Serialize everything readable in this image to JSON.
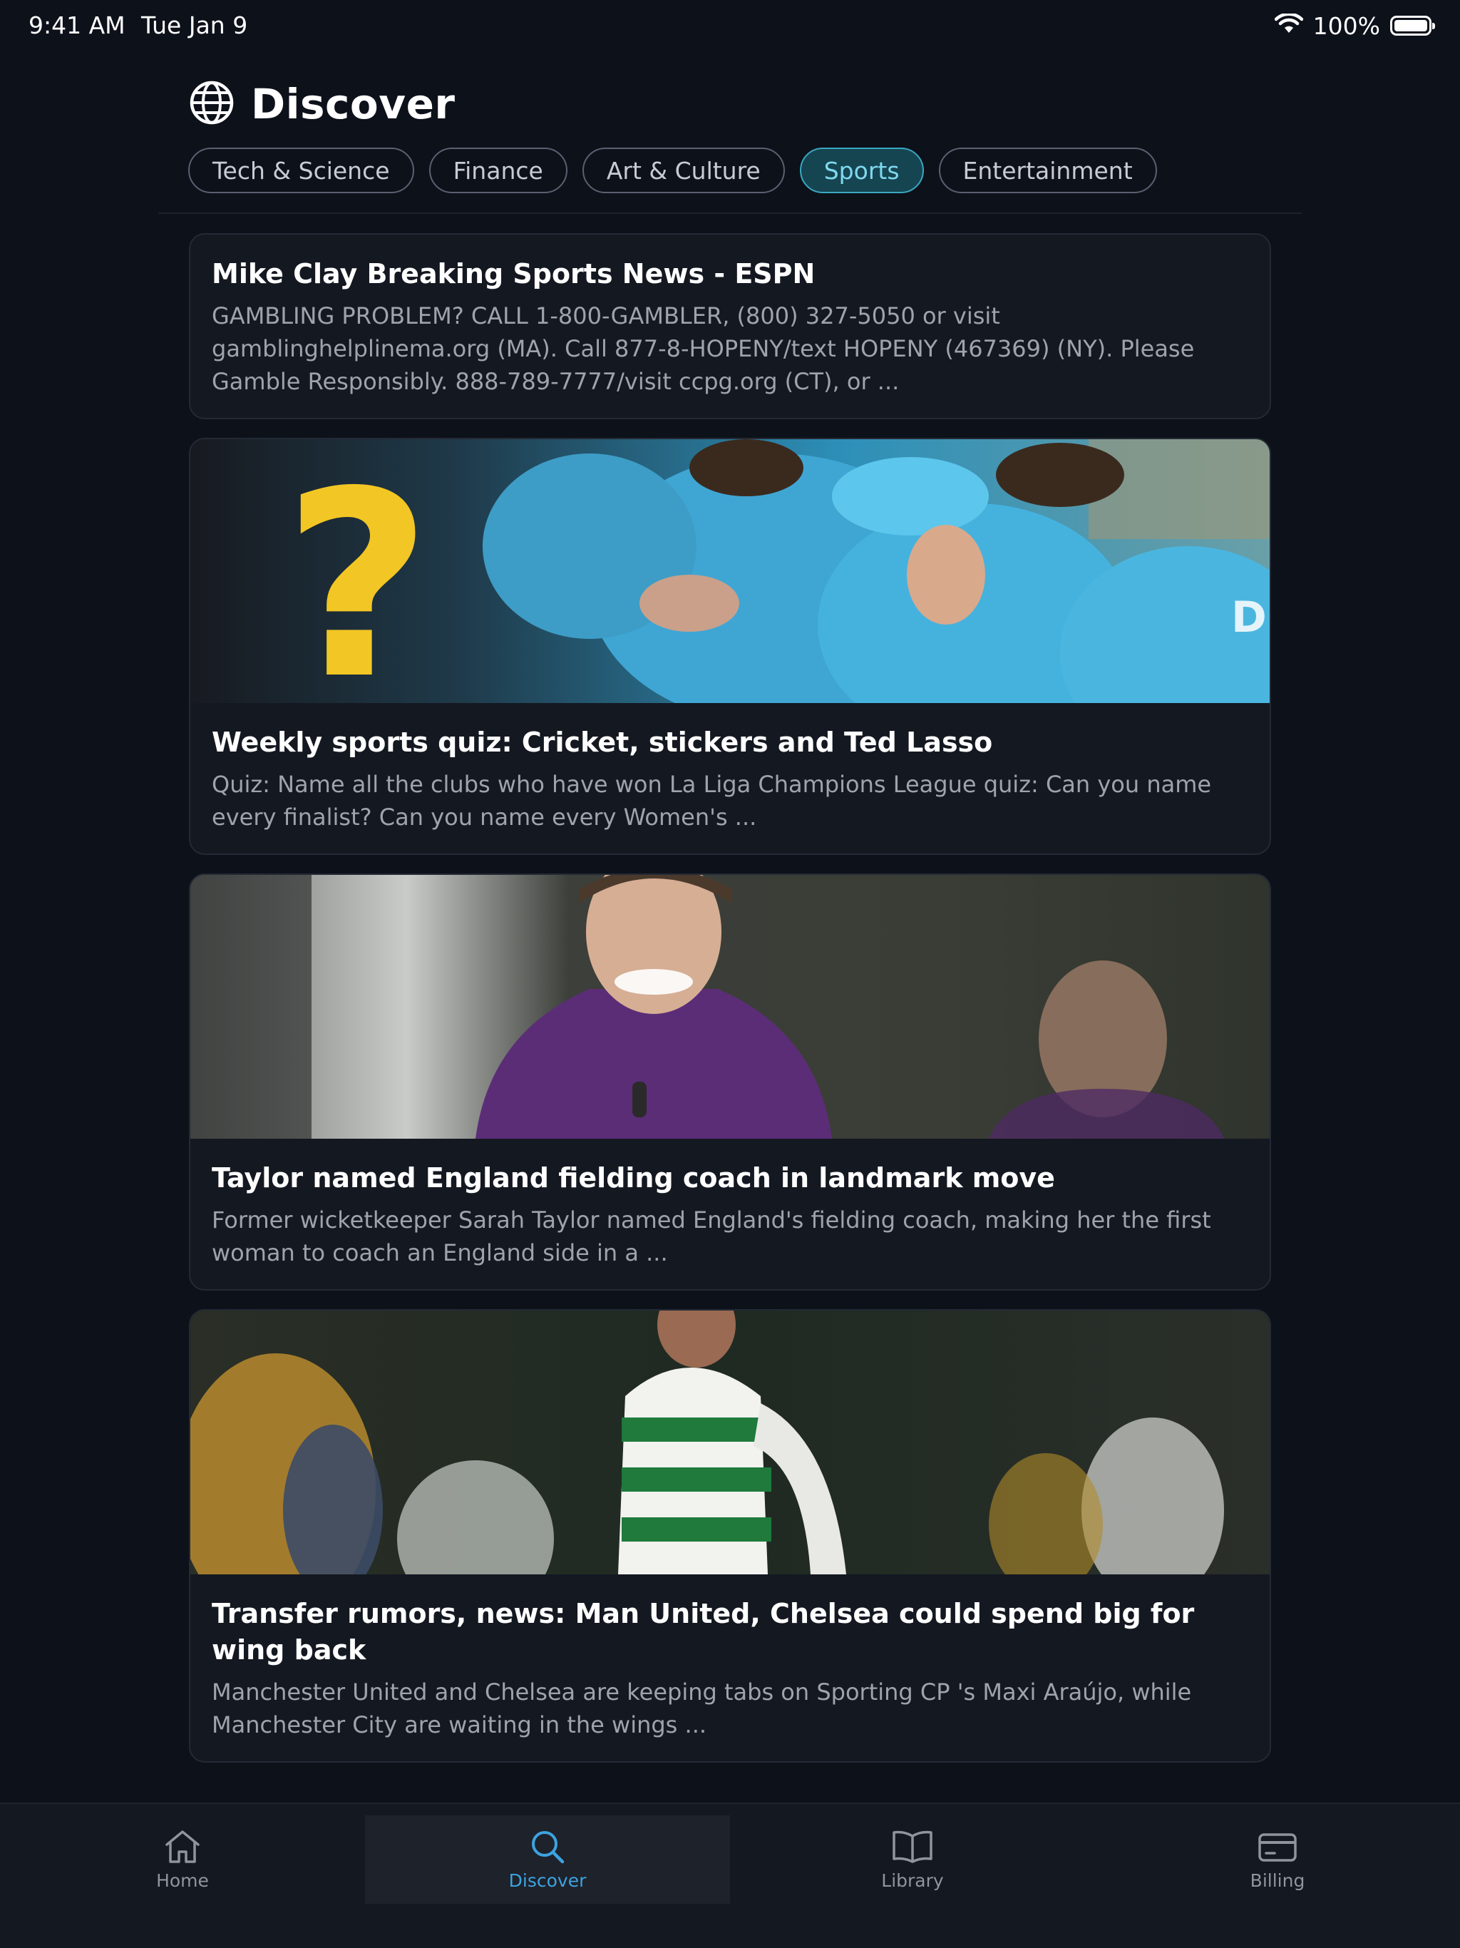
{
  "status_bar": {
    "time": "9:41 AM",
    "date": "Tue Jan 9",
    "battery_percent": "100%",
    "battery_level": 1.0
  },
  "header": {
    "title": "Discover",
    "icon": "globe-icon"
  },
  "categories": {
    "selected": "Sports",
    "items": [
      {
        "label": "Tech & Science"
      },
      {
        "label": "Finance"
      },
      {
        "label": "Art & Culture"
      },
      {
        "label": "Sports"
      },
      {
        "label": "Entertainment"
      }
    ]
  },
  "articles": [
    {
      "title": "Mike Clay Breaking Sports News - ESPN",
      "description": "GAMBLING PROBLEM? CALL 1-800-GAMBLER, (800) 327-5050 or visit gamblinghelplinema.org (MA). Call 877-8-HOPENY/text HOPENY (467369) (NY). Please Gamble Responsibly. 888-789-7777/visit ccpg.org (CT), or ...",
      "has_image": false
    },
    {
      "title": "Weekly sports quiz: Cricket, stickers and Ted Lasso",
      "description": "Quiz: Name all the clubs who have won La Liga Champions League quiz: Can you name every finalist? Can you name every Women's ...",
      "has_image": true,
      "image": "cricket-team-celebration-photo"
    },
    {
      "title": "Taylor named England fielding coach in landmark move",
      "description": "Former wicketkeeper Sarah Taylor named England's fielding coach, making her the first woman to coach an England side in a ...",
      "has_image": true,
      "image": "england-coach-photo"
    },
    {
      "title": "Transfer rumors, news: Man United, Chelsea could spend big for wing back",
      "description": "Manchester United and Chelsea are keeping tabs on Sporting CP 's Maxi Araújo, while Manchester City are waiting in the wings ...",
      "has_image": true,
      "image": "sporting-cp-player-photo"
    }
  ],
  "tab_bar": {
    "selected": "Discover",
    "tabs": [
      {
        "label": "Home",
        "icon": "home-icon"
      },
      {
        "label": "Discover",
        "icon": "search-icon"
      },
      {
        "label": "Library",
        "icon": "book-icon"
      },
      {
        "label": "Billing",
        "icon": "credit-card-icon"
      }
    ]
  },
  "colors": {
    "background": "#0d111a",
    "card": "#141821",
    "accent": "#3da3e0",
    "chip_active_bg": "#164552",
    "chip_active_text": "#7fd9ee"
  }
}
